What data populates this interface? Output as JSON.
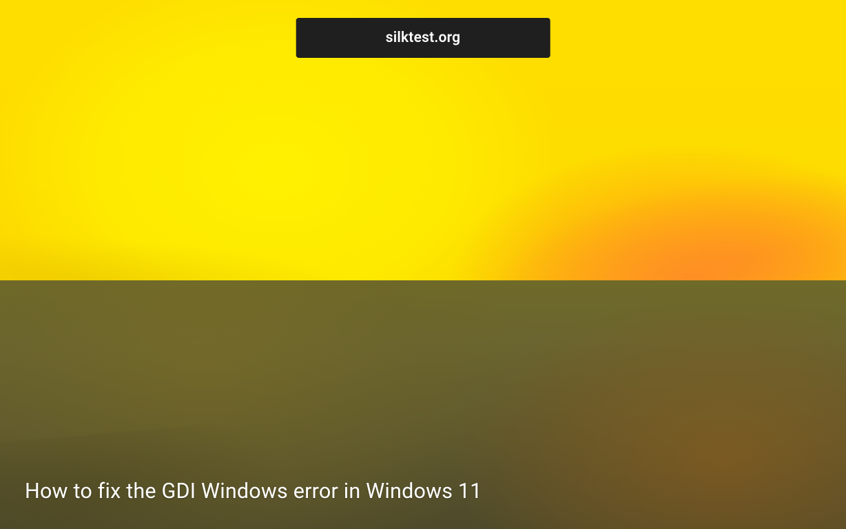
{
  "brand": {
    "label": "silktest.org"
  },
  "article": {
    "headline": "How to fix the GDI Windows error in Windows 11"
  }
}
